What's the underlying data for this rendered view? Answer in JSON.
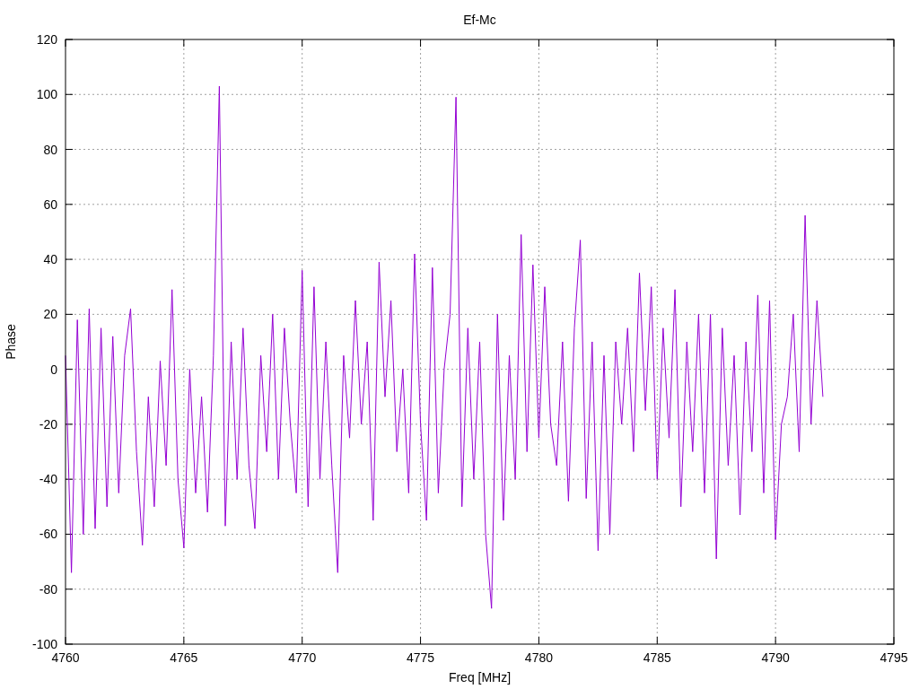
{
  "chart_data": {
    "type": "line",
    "grid": true,
    "title": "Ef-Mc",
    "xlabel": "Freq [MHz]",
    "ylabel": "Phase",
    "xlim": [
      4760,
      4795
    ],
    "ylim": [
      -100,
      120
    ],
    "xticks": [
      4760,
      4765,
      4770,
      4775,
      4780,
      4785,
      4790,
      4795
    ],
    "yticks": [
      -100,
      -80,
      -60,
      -40,
      -20,
      0,
      20,
      40,
      60,
      80,
      100,
      120
    ],
    "x": [
      4760,
      4760.25,
      4760.5,
      4760.75,
      4761,
      4761.25,
      4761.5,
      4761.75,
      4762,
      4762.25,
      4762.5,
      4762.75,
      4763,
      4763.25,
      4763.5,
      4763.75,
      4764,
      4764.25,
      4764.5,
      4764.75,
      4765,
      4765.25,
      4765.5,
      4765.75,
      4766,
      4766.25,
      4766.5,
      4766.75,
      4767,
      4767.25,
      4767.5,
      4767.75,
      4768,
      4768.25,
      4768.5,
      4768.75,
      4769,
      4769.25,
      4769.5,
      4769.75,
      4770,
      4770.25,
      4770.5,
      4770.75,
      4771,
      4771.25,
      4771.5,
      4771.75,
      4772,
      4772.25,
      4772.5,
      4772.75,
      4773,
      4773.25,
      4773.5,
      4773.75,
      4774,
      4774.25,
      4774.5,
      4774.75,
      4775,
      4775.25,
      4775.5,
      4775.75,
      4776,
      4776.25,
      4776.5,
      4776.75,
      4777,
      4777.25,
      4777.5,
      4777.75,
      4778,
      4778.25,
      4778.5,
      4778.75,
      4779,
      4779.25,
      4779.5,
      4779.75,
      4780,
      4780.25,
      4780.5,
      4780.75,
      4781,
      4781.25,
      4781.5,
      4781.75,
      4782,
      4782.25,
      4782.5,
      4782.75,
      4783,
      4783.25,
      4783.5,
      4783.75,
      4784,
      4784.25,
      4784.5,
      4784.75,
      4785,
      4785.25,
      4785.5,
      4785.75,
      4786,
      4786.25,
      4786.5,
      4786.75,
      4787,
      4787.25,
      4787.5,
      4787.75,
      4788,
      4788.25,
      4788.5,
      4788.75,
      4789,
      4789.25,
      4789.5,
      4789.75,
      4790,
      4790.25,
      4790.5,
      4790.75,
      4791,
      4791.25,
      4791.5,
      4791.75,
      4792
    ],
    "series": [
      {
        "color": "#9400d3",
        "values": [
          5,
          -74,
          18,
          -60,
          22,
          -58,
          15,
          -50,
          12,
          -45,
          5,
          22,
          -30,
          -64,
          -10,
          -50,
          3,
          -35,
          29,
          -40,
          -65,
          0,
          -45,
          -10,
          -52,
          5,
          103,
          -57,
          10,
          -40,
          15,
          -35,
          -58,
          5,
          -30,
          20,
          -40,
          15,
          -20,
          -45,
          36,
          -50,
          30,
          -40,
          10,
          -35,
          -74,
          5,
          -25,
          25,
          -20,
          10,
          -55,
          39,
          -10,
          25,
          -30,
          0,
          -45,
          42,
          -20,
          -55,
          37,
          -45,
          0,
          20,
          99,
          -50,
          15,
          -40,
          10,
          -60,
          -87,
          20,
          -55,
          5,
          -40,
          49,
          -30,
          38,
          -25,
          30,
          -20,
          -35,
          10,
          -48,
          15,
          47,
          -47,
          10,
          -66,
          5,
          -60,
          10,
          -20,
          15,
          -30,
          35,
          -15,
          30,
          -40,
          15,
          -25,
          29,
          -50,
          10,
          -30,
          20,
          -45,
          20,
          -69,
          15,
          -35,
          5,
          -53,
          10,
          -30,
          27,
          -45,
          25,
          -62,
          -20,
          -10,
          20,
          -30,
          56,
          -20,
          25,
          -10
        ]
      }
    ]
  }
}
